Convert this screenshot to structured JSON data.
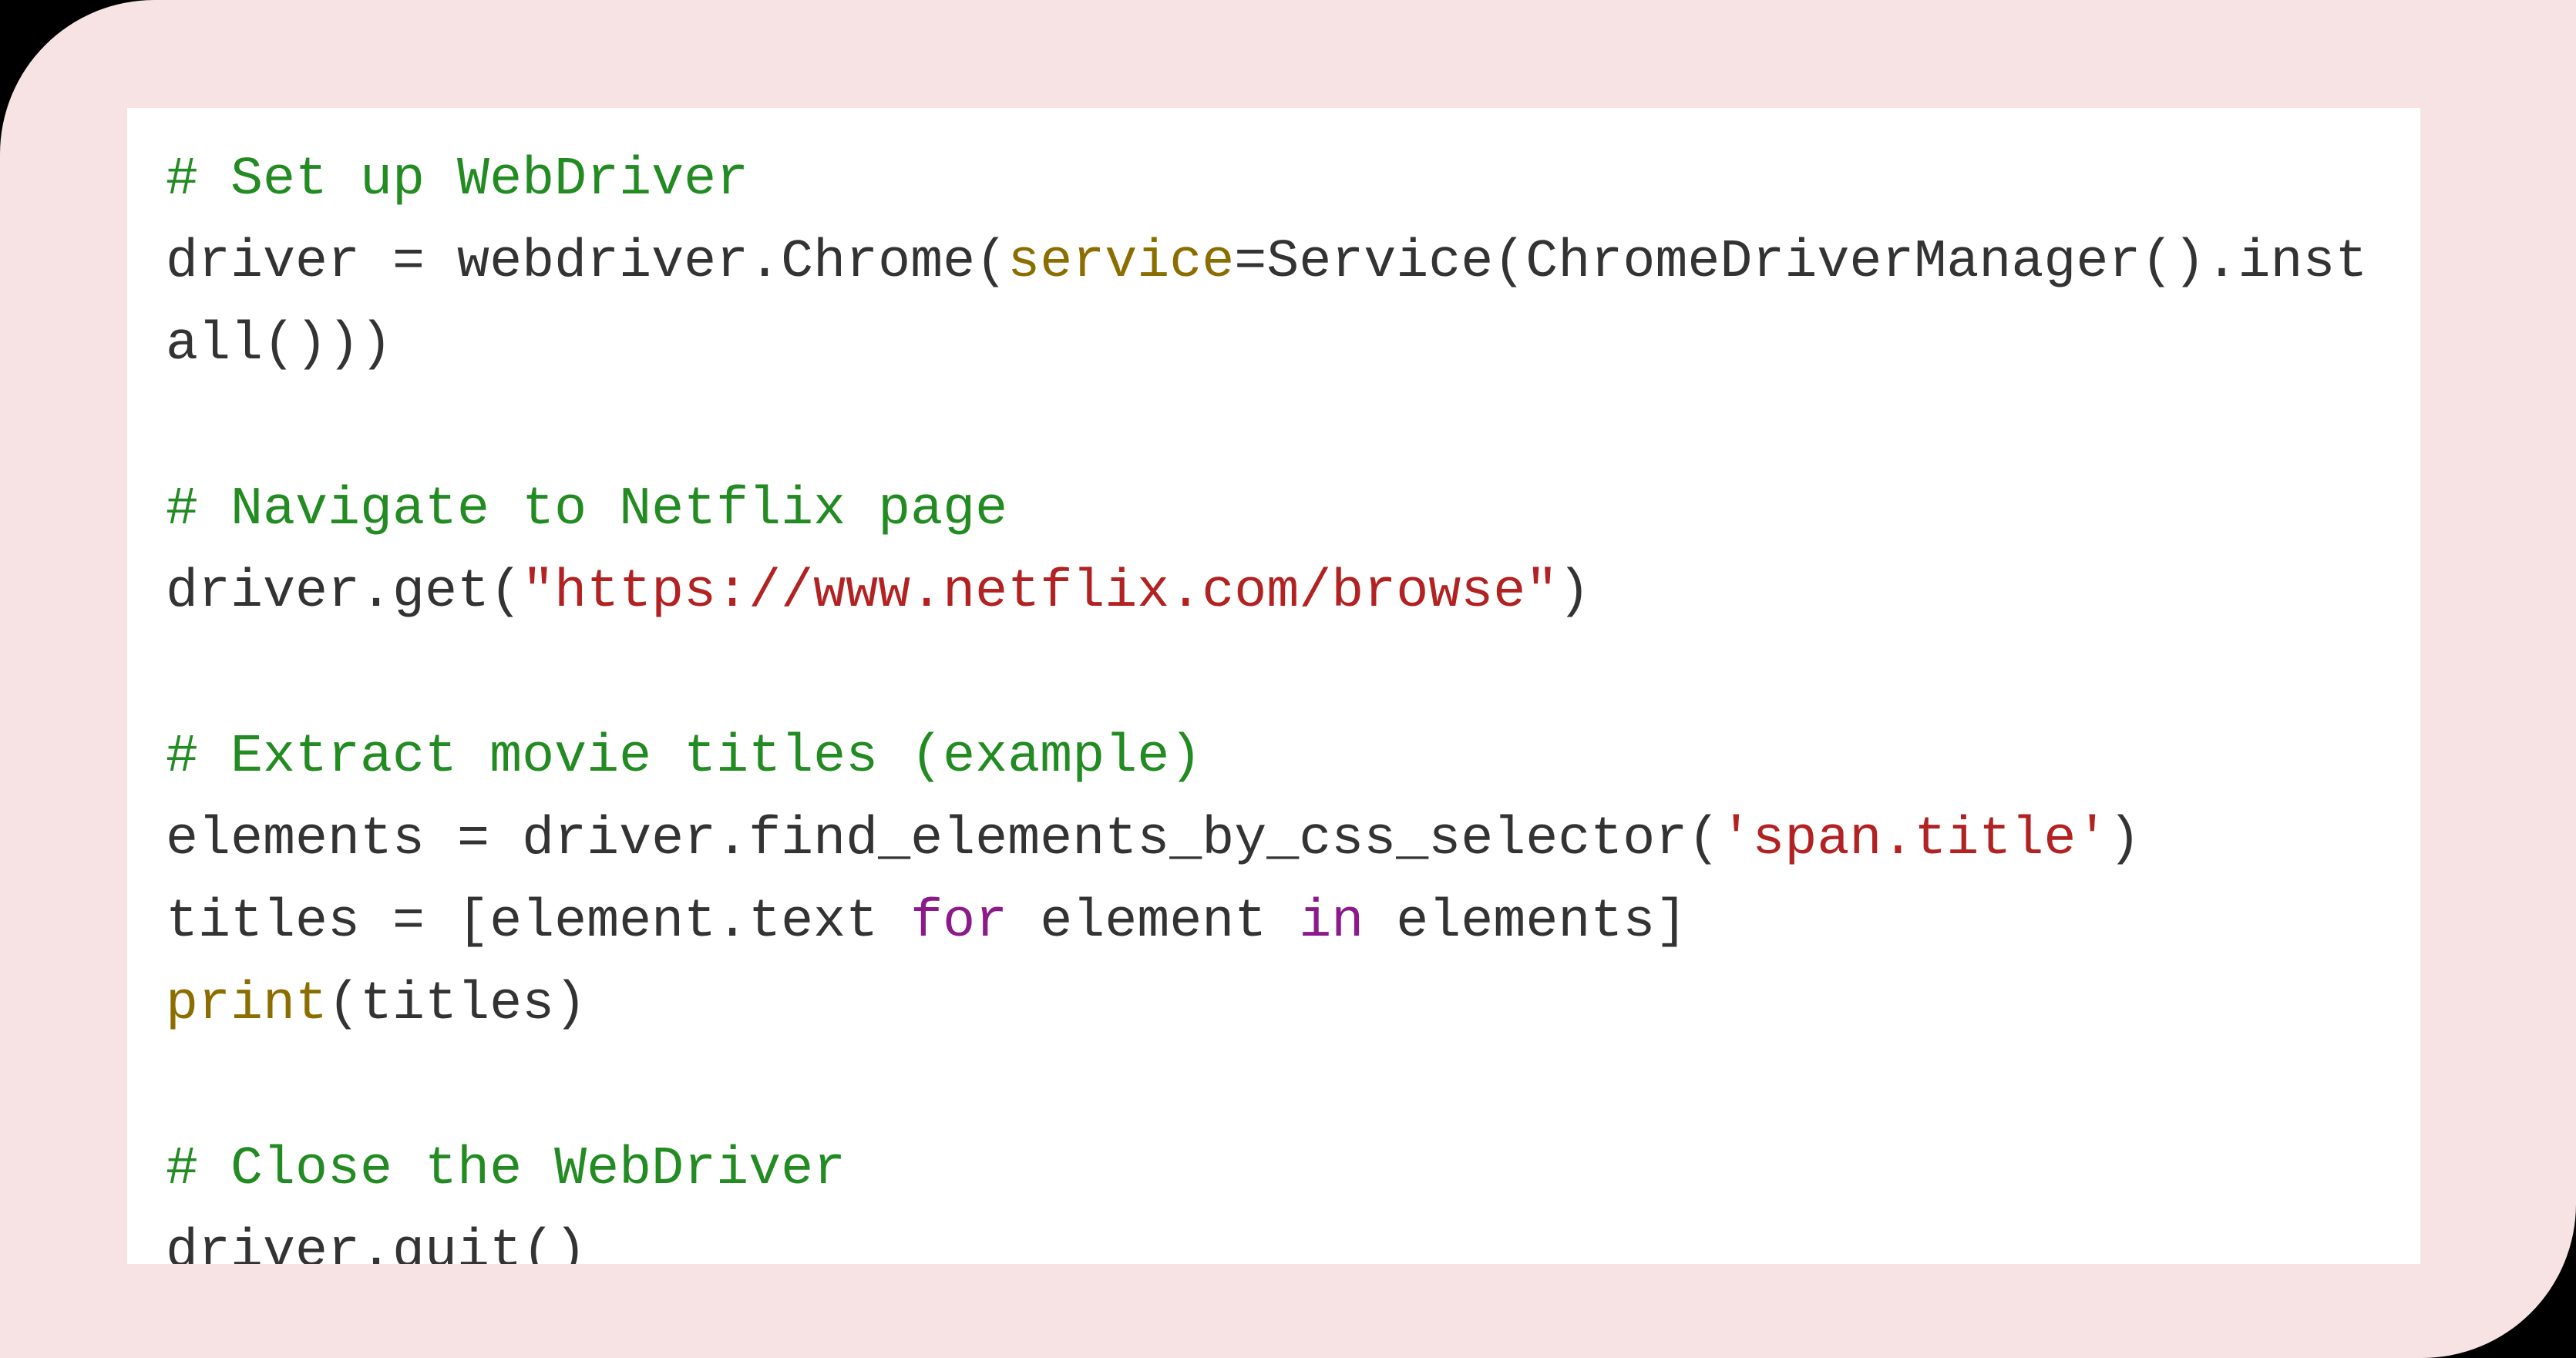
{
  "code": {
    "lines": [
      [
        {
          "cls": "tok-comment",
          "t": "# Set up WebDriver"
        }
      ],
      [
        {
          "cls": "tok-plain",
          "t": "driver = webdriver.Chrome("
        },
        {
          "cls": "tok-builtin",
          "t": "service"
        },
        {
          "cls": "tok-plain",
          "t": "=Service(ChromeDriverManager().install()))"
        }
      ],
      [],
      [
        {
          "cls": "tok-comment",
          "t": "# Navigate to Netflix page"
        }
      ],
      [
        {
          "cls": "tok-plain",
          "t": "driver.get("
        },
        {
          "cls": "tok-str",
          "t": "\"https://www.netflix.com/browse\""
        },
        {
          "cls": "tok-plain",
          "t": ")"
        }
      ],
      [],
      [
        {
          "cls": "tok-comment",
          "t": "# Extract movie titles (example)"
        }
      ],
      [
        {
          "cls": "tok-plain",
          "t": "elements = driver.find_elements_by_css_selector("
        },
        {
          "cls": "tok-str",
          "t": "'span.title'"
        },
        {
          "cls": "tok-plain",
          "t": ")"
        }
      ],
      [
        {
          "cls": "tok-plain",
          "t": "titles = [element.text "
        },
        {
          "cls": "tok-kw",
          "t": "for"
        },
        {
          "cls": "tok-plain",
          "t": " element "
        },
        {
          "cls": "tok-kw",
          "t": "in"
        },
        {
          "cls": "tok-plain",
          "t": " elements]"
        }
      ],
      [
        {
          "cls": "tok-builtin",
          "t": "print"
        },
        {
          "cls": "tok-plain",
          "t": "(titles)"
        }
      ],
      [],
      [
        {
          "cls": "tok-comment",
          "t": "# Close the WebDriver"
        }
      ],
      [
        {
          "cls": "tok-plain",
          "t": "driver.quit()"
        }
      ]
    ]
  }
}
